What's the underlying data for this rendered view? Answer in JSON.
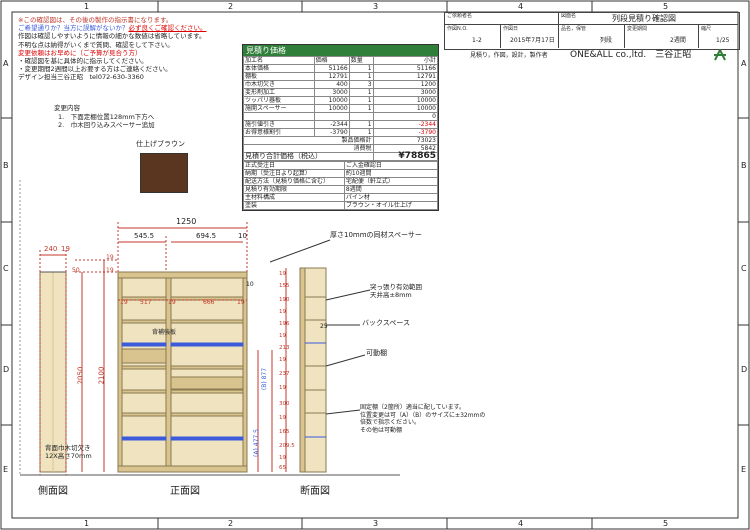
{
  "grid": {
    "cols": [
      "1",
      "2",
      "3",
      "4",
      "5"
    ],
    "rows": [
      "A",
      "B",
      "C",
      "D",
      "E"
    ]
  },
  "notes": {
    "l1": "※この確認図は、その後の製作の指示書になります。",
    "l2a": "ご希望通りか？当方に誤解がないか？",
    "l2b": "必ず良くご確認ください。",
    "l3": "作図は確認しやすいように情報の細かな数値は省略しています。",
    "l4": "不明な点は納得がいくまで質問、確認をして下さい。",
    "l5": "変更依頼はお早めに（ご予算が見合う方）",
    "l6": "・確認図を基に具体的に指示してください。",
    "l7": "・変更期間2週間以上お要する方はご連絡ください。",
    "l8": "デザイン担当三谷正昭　tel072-630-3360"
  },
  "changes": {
    "title": "変更内容",
    "item1": "1.　下面定棚位置128mm下方へ",
    "item2": "2.　巾木回り込みスペーサー追加"
  },
  "finish": {
    "label": "仕上げブラウン",
    "swatch_color": "#5a3520"
  },
  "price": {
    "title": "見積り価格",
    "headers": [
      "加工名",
      "価格",
      "数量",
      "小計"
    ],
    "rows": [
      [
        "本体価格",
        "51166",
        "1",
        "51166"
      ],
      [
        "棚板",
        "12791",
        "1",
        "12791"
      ],
      [
        "巾木切欠き",
        "400",
        "3",
        "1200"
      ],
      [
        "変形剤加工",
        "3000",
        "1",
        "3000"
      ],
      [
        "ツッパリ器板",
        "10000",
        "1",
        "10000"
      ],
      [
        "施開スペーサー",
        "10000",
        "1",
        "10000"
      ],
      [
        "",
        "",
        "",
        "0"
      ],
      [
        "施引値引き",
        "-2344",
        "1",
        "-2344"
      ],
      [
        "お得意様割引",
        "-3790",
        "1",
        "-3790"
      ]
    ],
    "product_label": "製品価格計",
    "product_value": "73023",
    "tax_label": "消費税",
    "tax_value": "5842",
    "total_label": "見積り合計価格（税込）",
    "total_value": "¥78865"
  },
  "order": {
    "rows": [
      [
        "正式受注日",
        "ご入金確認日"
      ],
      [
        "納期（受注日より起算）",
        "約10週間"
      ],
      [
        "配送方法（見積り価格に含む）",
        "宅配便（軒立式）"
      ],
      [
        "見積り有効期限",
        "8週間"
      ],
      [
        "主材料構成",
        "パイン材"
      ],
      [
        "塗装",
        "ブラウン・オイル仕上げ"
      ]
    ]
  },
  "titleblock": {
    "customer_label": "ご依頼者名",
    "drawing_name_label": "図面名",
    "drawing_name": "列段見積り確認図",
    "no_label": "作図N.O.",
    "no_value": "1-2",
    "date_label": "作図日",
    "date_value": "2015年7月17日",
    "status_label": "品名，保管",
    "status_value": "列段",
    "change_label": "変更期間",
    "change_value": "2週間",
    "scale_label": "縮尺",
    "scale_value": "1/25",
    "company_desc": "見積り，作図，設計，製作者",
    "company": "ONE&ALL co.,ltd.　三谷正昭"
  },
  "dims": {
    "d240": "240",
    "d19a": "19",
    "d1250": "1250",
    "d545": "545.5",
    "d694": "694.5",
    "d10": "10",
    "d50": "50",
    "d19b": "19",
    "d19c": "19",
    "d19d": "19",
    "d517": "517",
    "d19e": "19",
    "d666": "666",
    "d19f": "19",
    "d2050": "2050",
    "d2100": "2100",
    "d10b": "10",
    "side_dims": [
      "19",
      "155",
      "190",
      "19",
      "196",
      "19",
      "213",
      "19",
      "237",
      "19",
      "300",
      "19",
      "165",
      "209.5",
      "19",
      "65"
    ],
    "b877": "(B) 877",
    "a477": "(A) 477.5",
    "d25": "25"
  },
  "callouts": {
    "spacer": "厚さ10mmの同材スペーサー",
    "tension": "突っ張り有効範囲\n天井高±8mm",
    "tension1": "突っ張り有効範囲",
    "tension2": "天井高±8mm",
    "backspace": "バックスペース",
    "movable": "可動棚",
    "fixed1": "固定棚（2箇所）適当に配しています。",
    "fixed2": "位置変更は可（A）（B）のサイズに±32mmの",
    "fixed3": "倍数で指示ください。",
    "fixed4": "その他は可動棚",
    "backplate": "背補強板",
    "baseboard1": "背面巾木切欠き",
    "baseboard2": "12X高さ70mm"
  },
  "views": {
    "side": "側面図",
    "front": "正面図",
    "section": "断面図"
  },
  "colors": {
    "wood": "#efe3c0",
    "wood_dark": "#d9c48f",
    "dim_red": "#c0392b",
    "header_green": "#2f7f3a",
    "shelf_blue": "#3b5bdb"
  }
}
